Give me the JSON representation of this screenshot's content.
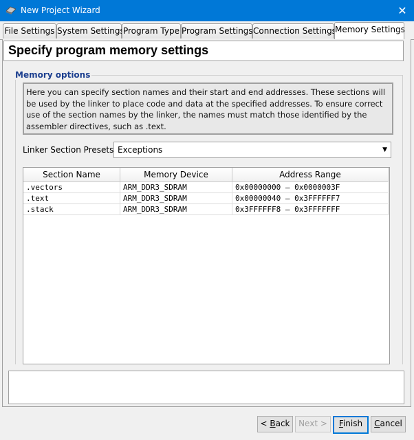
{
  "window": {
    "title": "New Project Wizard",
    "close_glyph": "✕"
  },
  "tabs": [
    {
      "label": "File Settings"
    },
    {
      "label": "System Settings"
    },
    {
      "label": "Program Type"
    },
    {
      "label": "Program Settings"
    },
    {
      "label": "Connection Settings"
    },
    {
      "label": "Memory Settings",
      "active": true
    }
  ],
  "heading": "Specify program memory settings",
  "memory_options": {
    "legend": "Memory options",
    "description": "Here you can specify section names and their start and end addresses. These sections will be used by the linker to place code and data at the specified addresses. To ensure correct use of the section names by the linker, the names must match those identified by the assembler directives, such as .text."
  },
  "presets": {
    "label": "Linker Section Presets:",
    "value": "Exceptions"
  },
  "table": {
    "headers": [
      "Section Name",
      "Memory Device",
      "Address Range"
    ],
    "rows": [
      [
        ".vectors",
        "ARM_DDR3_SDRAM",
        "0x00000000 – 0x0000003F"
      ],
      [
        ".text",
        "ARM_DDR3_SDRAM",
        "0x00000040 – 0x3FFFFFF7"
      ],
      [
        ".stack",
        "ARM_DDR3_SDRAM",
        "0x3FFFFFF8 – 0x3FFFFFFF"
      ]
    ]
  },
  "buttons": {
    "back_mnemonic": "B",
    "back_rest": "ack",
    "back_prefix": "< ",
    "next": "Next >",
    "finish_mnemonic": "F",
    "finish_rest": "inish",
    "cancel_mnemonic": "C",
    "cancel_rest": "ancel"
  },
  "colors": {
    "titlebar": "#0078d7",
    "legend": "#1c3f8f",
    "default_button_border": "#0078d7"
  }
}
